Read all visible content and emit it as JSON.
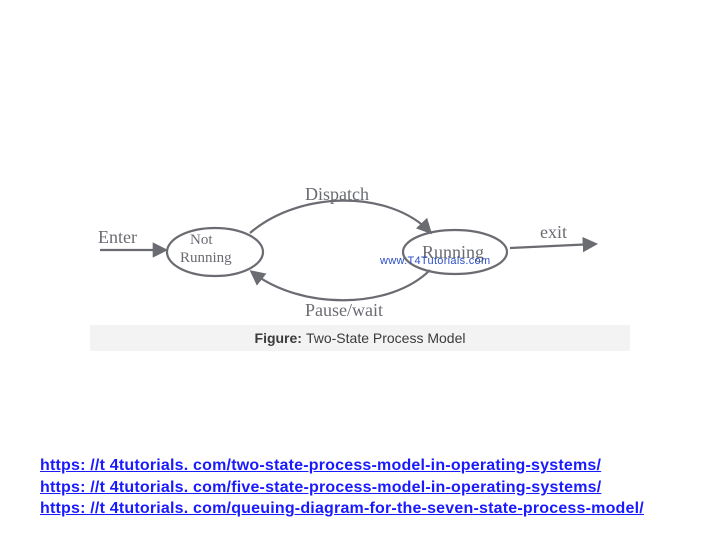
{
  "diagram": {
    "enter_label": "Enter",
    "state_not_running": "Not Running",
    "state_running": "Running",
    "dispatch_label": "Dispatch",
    "pause_label": "Pause/wait",
    "exit_label": "exit",
    "watermark": "www.T4Tutorials.com"
  },
  "caption": {
    "prefix": "Figure:",
    "text": "Two-State Process Model"
  },
  "links": {
    "l1": "https: //t 4tutorials. com/two-state-process-model-in-operating-systems/",
    "l2": "https: //t 4tutorials. com/five-state-process-model-in-operating-systems/",
    "l3": "https: //t 4tutorials. com/queuing-diagram-for-the-seven-state-process-model/"
  }
}
